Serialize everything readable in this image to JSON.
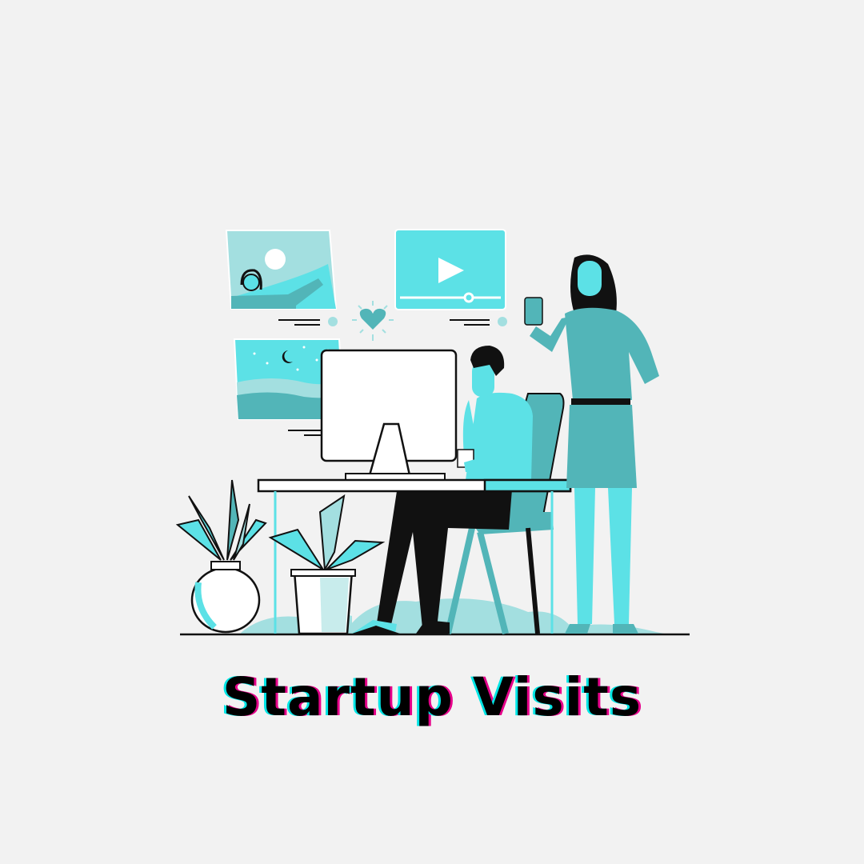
{
  "title": "Startup Visits",
  "colors": {
    "background": "#f2f2f2",
    "accent_light": "#5ce1e6",
    "accent_mid": "#52b5b8",
    "accent_pale": "#a3dfe0",
    "ink": "#111111",
    "title_shadow_left": "#00e5e5",
    "title_shadow_right": "#e6008a"
  },
  "illustration": {
    "elements": [
      "landscape-photo-card",
      "video-player-card",
      "night-landscape-card",
      "heart-icon",
      "desktop-monitor",
      "desk",
      "seated-man",
      "office-chair",
      "standing-woman",
      "smartphone",
      "potted-plant-round",
      "potted-plant-square"
    ]
  }
}
